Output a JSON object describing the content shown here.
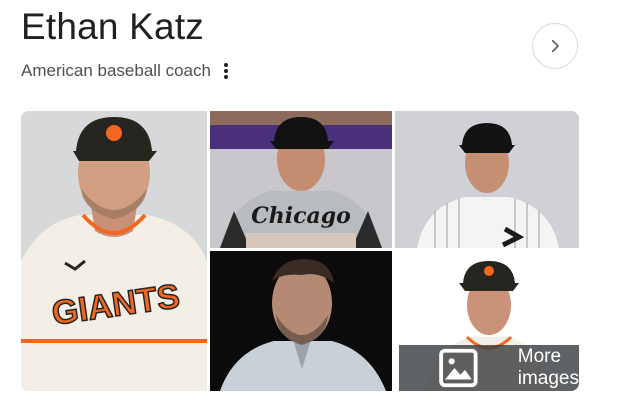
{
  "knowledge_panel": {
    "title": "Ethan Katz",
    "subtitle": "American baseball coach",
    "more_images_label": "More images",
    "icons": {
      "options": "vertical-dots-icon",
      "next": "chevron-right-icon",
      "images": "image-icon"
    },
    "images": [
      {
        "name": "giants-portrait",
        "jersey_text": "GIANTS"
      },
      {
        "name": "white-sox-gray-jersey",
        "jersey_text": "Chicago"
      },
      {
        "name": "white-sox-pinstripe",
        "jersey_text": ""
      },
      {
        "name": "dark-portrait",
        "jersey_text": ""
      },
      {
        "name": "giants-headshot",
        "jersey_text": ""
      }
    ],
    "colors": {
      "giants_orange": "#f26722",
      "giants_cap": "#27251f",
      "sox_black": "#1a1a1a"
    }
  }
}
